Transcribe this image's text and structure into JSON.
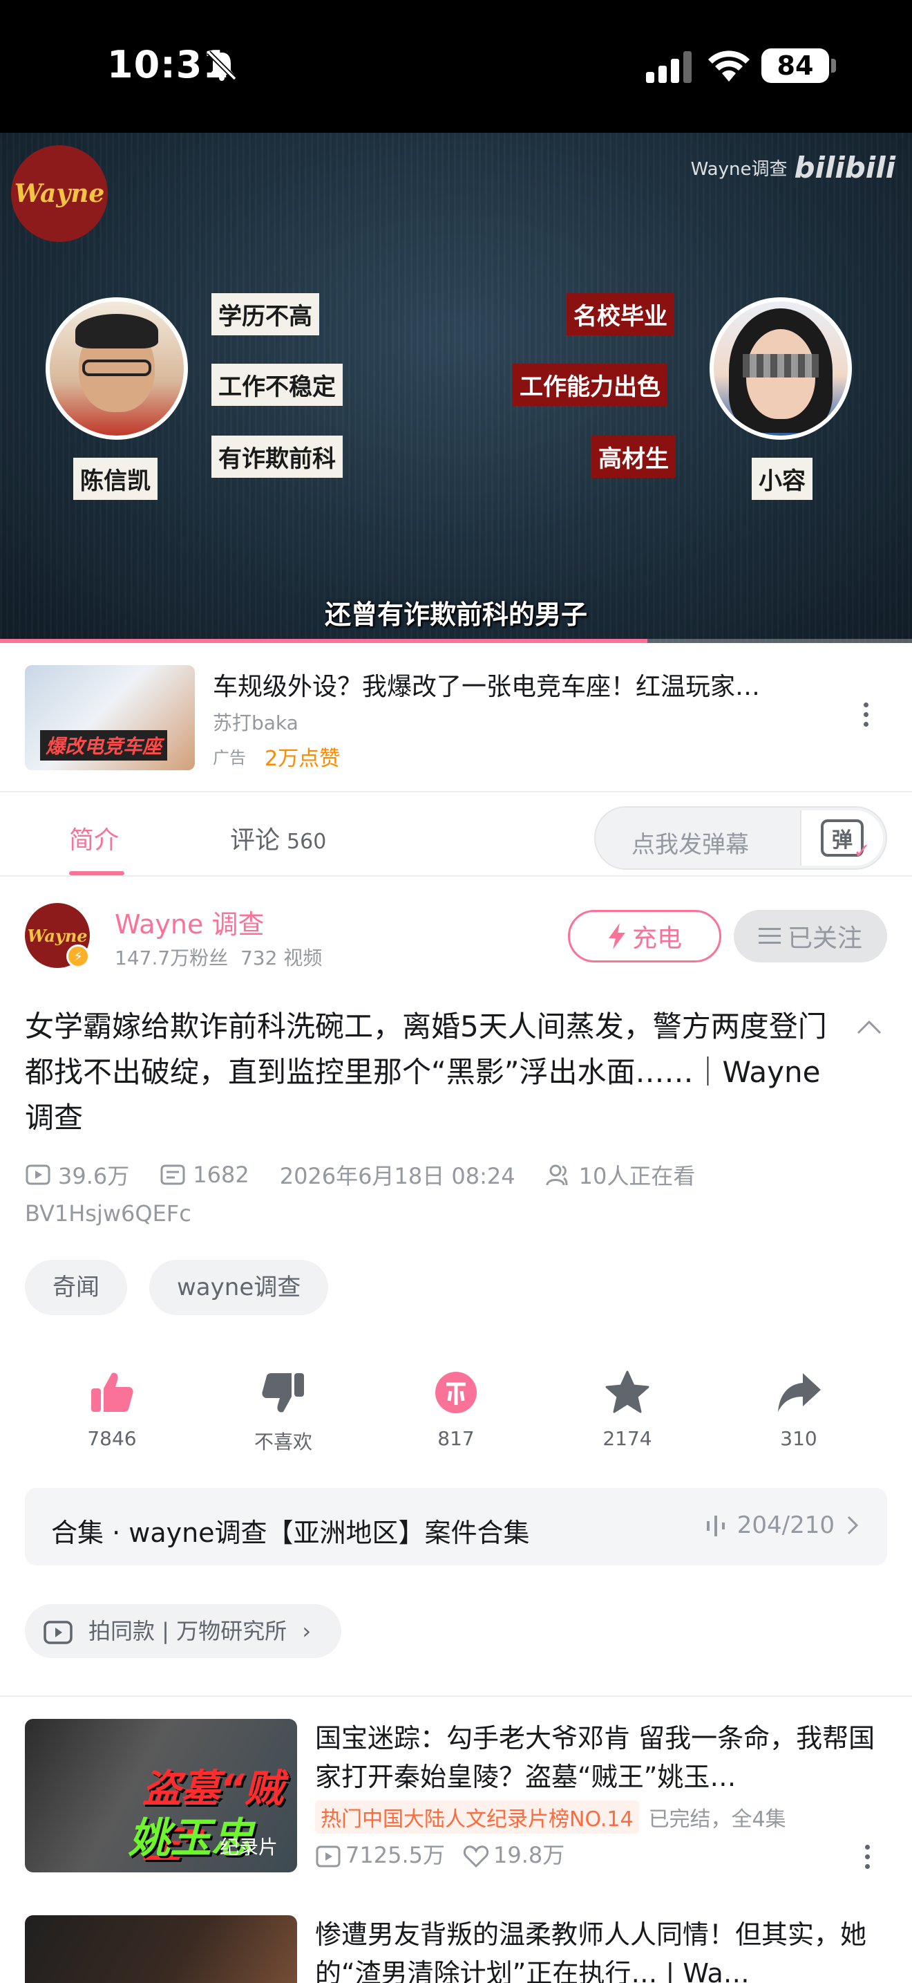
{
  "status_bar": {
    "time": "10:31",
    "battery": "84"
  },
  "video": {
    "logo": "Wayne",
    "watermark": "Wayne调查",
    "watermark_brand": "bilibili",
    "man_name": "陈信凯",
    "woman_name": "小容",
    "man_tags": [
      "学历不高",
      "工作不稳定",
      "有诈欺前科"
    ],
    "woman_tags": [
      "名校毕业",
      "工作能力出色",
      "高材生"
    ],
    "subtitle": "还曾有诈欺前科的男子",
    "progress": 0.71
  },
  "ad": {
    "thumb_text": "爆改电竞车座",
    "title": "车规级外设？我爆改了一张电竞车座！红温玩家…",
    "author": "苏打baka",
    "label": "广告",
    "likes": "2万点赞"
  },
  "tabs": {
    "intro": "简介",
    "comments": "评论",
    "comment_count": "560",
    "danmaku_placeholder": "点我发弹幕",
    "danmaku_icon": "弹"
  },
  "uploader": {
    "avatar_text": "Wayne",
    "name": "Wayne 调查",
    "fans": "147.7万粉丝",
    "videos": "732 视频",
    "charge_label": "充电",
    "follow_label": "已关注"
  },
  "video_info": {
    "title": "女学霸嫁给欺诈前科洗碗工，离婚5天人间蒸发，警方两度登门都找不出破绽，直到监控里那个“黑影”浮出水面……｜Wayne调查",
    "views": "39.6万",
    "danmaku_count": "1682",
    "date": "2026年6月18日 08:24",
    "watching": "10人正在看",
    "bvid": "BV1Hsjw6QEFc",
    "tags": [
      "奇闻",
      "wayne调查"
    ]
  },
  "actions": [
    {
      "icon": "thumbs-up-icon",
      "label": "7846"
    },
    {
      "icon": "thumbs-down-icon",
      "label": "不喜欢"
    },
    {
      "icon": "coin-icon",
      "label": "817"
    },
    {
      "icon": "star-icon",
      "label": "2174"
    },
    {
      "icon": "share-icon",
      "label": "310"
    }
  ],
  "collection": {
    "title": "合集 · wayne调查【亚洲地区】案件合集",
    "progress": "204/210"
  },
  "same_style": "拍同款 | 万物研究所",
  "recommendations": [
    {
      "title": "国宝迷踪：勾手老大爷邓肯  留我一条命，我帮国家打开秦始皇陵？盗墓“贼王”姚玉…",
      "thumb_line1": "盗墓“贼王”",
      "thumb_line2": "姚玉忠",
      "thumb_label": "纪录片",
      "badge": "热门中国大陆人文纪录片榜NO.14",
      "status": "已完结，全4集",
      "views": "7125.5万",
      "likes": "19.8万"
    },
    {
      "title": "惨遭男友背叛的温柔教师人人同情！但其实，她的“渣男清除计划”正在执行… | Wa…"
    }
  ],
  "colors": {
    "accent": "#fb7299",
    "text": "#18191c",
    "muted": "#9499a0"
  }
}
